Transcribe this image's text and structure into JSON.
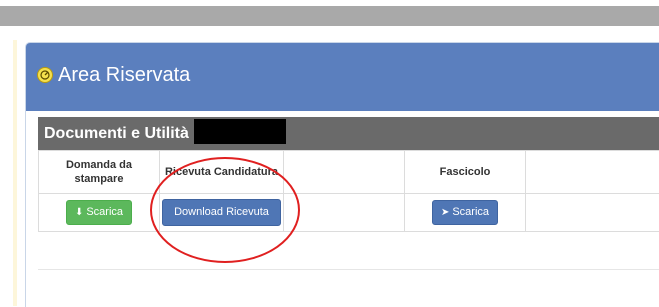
{
  "panel": {
    "title": "Area Riservata",
    "icon": "dashboard-icon",
    "colors": {
      "heading": "#5b7fbe",
      "icon": "#f4e04d"
    }
  },
  "docs": {
    "title": "Documenti e Utilità -",
    "header_color": "#6a6a6a",
    "columns": [
      "Domanda da stampare",
      "Ricevuta Candidatura",
      "",
      "Fascicolo",
      ""
    ],
    "buttons": {
      "domanda": {
        "label": "Scarica",
        "icon": "download-icon",
        "color": "#5cb85c"
      },
      "ricevuta": {
        "label": "Download Ricevuta",
        "color": "#4f76b5"
      },
      "fascicolo": {
        "label": "Scarica",
        "icon": "send-icon",
        "color": "#4f76b5"
      }
    }
  },
  "annotation": {
    "shape": "red-ellipse",
    "color": "#e02020"
  }
}
